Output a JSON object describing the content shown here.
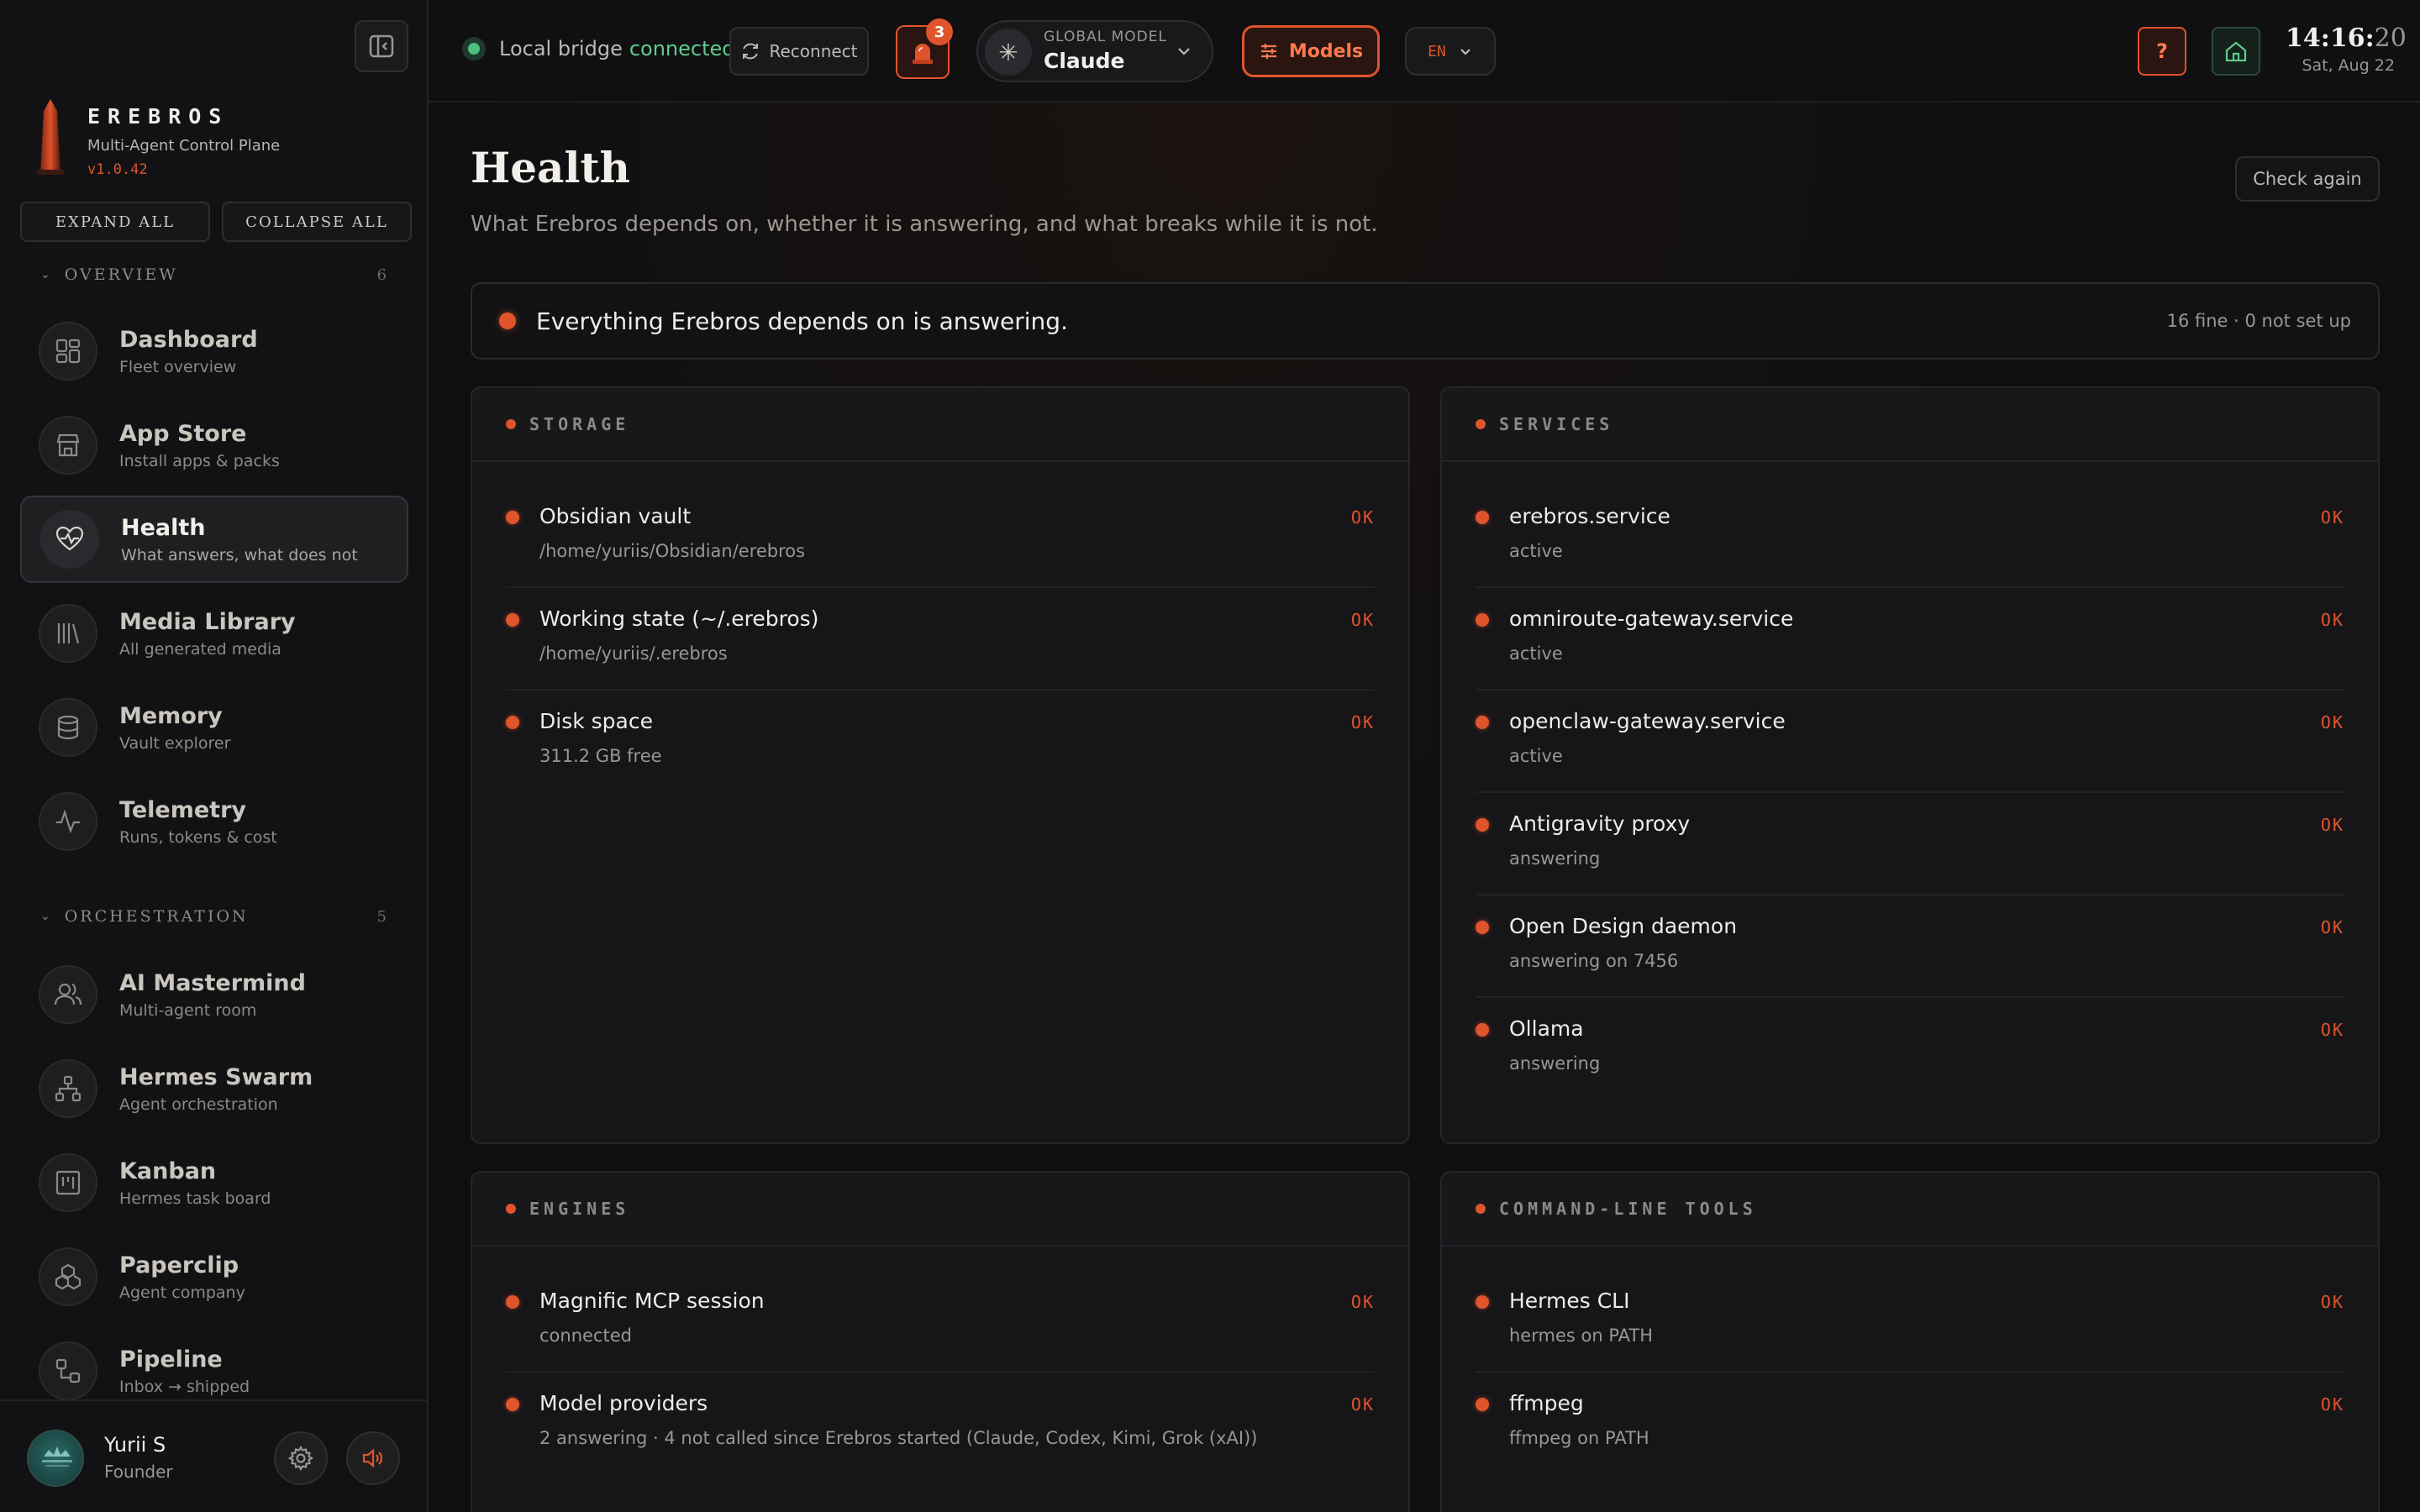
{
  "sidebar": {
    "brand": {
      "name": "EREBROS",
      "subtitle": "Multi-Agent Control Plane",
      "version": "v1.0.42"
    },
    "expand_all": "EXPAND ALL",
    "collapse_all": "COLLAPSE ALL",
    "sections": [
      {
        "label": "OVERVIEW",
        "count": "6"
      },
      {
        "label": "ORCHESTRATION",
        "count": "5"
      }
    ],
    "items": [
      {
        "title": "Dashboard",
        "subtitle": "Fleet overview",
        "icon": "dashboard-icon"
      },
      {
        "title": "App Store",
        "subtitle": "Install apps & packs",
        "icon": "store-icon"
      },
      {
        "title": "Health",
        "subtitle": "What answers, what does not",
        "icon": "heart-pulse-icon",
        "active": true
      },
      {
        "title": "Media Library",
        "subtitle": "All generated media",
        "icon": "library-icon"
      },
      {
        "title": "Memory",
        "subtitle": "Vault explorer",
        "icon": "database-icon"
      },
      {
        "title": "Telemetry",
        "subtitle": "Runs, tokens & cost",
        "icon": "activity-icon"
      },
      {
        "title": "AI Mastermind",
        "subtitle": "Multi-agent room",
        "icon": "users-icon"
      },
      {
        "title": "Hermes Swarm",
        "subtitle": "Agent orchestration",
        "icon": "network-icon"
      },
      {
        "title": "Kanban",
        "subtitle": "Hermes task board",
        "icon": "kanban-icon"
      },
      {
        "title": "Paperclip",
        "subtitle": "Agent company",
        "icon": "boxes-icon"
      },
      {
        "title": "Pipeline",
        "subtitle": "Inbox → shipped",
        "icon": "pipeline-icon"
      }
    ],
    "user": {
      "name": "Yurii S",
      "role": "Founder"
    }
  },
  "topbar": {
    "bridge_label": "Local bridge",
    "bridge_status": "connected",
    "reconnect": "Reconnect",
    "alarm_count": "3",
    "model_label": "GLOBAL MODEL",
    "model_value": "Claude",
    "models_button": "Models",
    "language": "EN",
    "help": "?",
    "clock_hm": "14:16:",
    "clock_s": "20",
    "date": "Sat, Aug 22"
  },
  "main": {
    "title": "Health",
    "subtitle": "What Erebros depends on, whether it is answering, and what breaks while it is not.",
    "check_again": "Check again",
    "summary_text": "Everything Erebros depends on is answering.",
    "summary_meta": "16 fine · 0 not set up",
    "cards": [
      {
        "title": "STORAGE",
        "rows": [
          {
            "name": "Obsidian vault",
            "detail": "/home/yuriis/Obsidian/erebros",
            "status": "OK"
          },
          {
            "name": "Working state (~/.erebros)",
            "detail": "/home/yuriis/.erebros",
            "status": "OK"
          },
          {
            "name": "Disk space",
            "detail": "311.2 GB free",
            "status": "OK"
          }
        ]
      },
      {
        "title": "SERVICES",
        "rows": [
          {
            "name": "erebros.service",
            "detail": "active",
            "status": "OK"
          },
          {
            "name": "omniroute-gateway.service",
            "detail": "active",
            "status": "OK"
          },
          {
            "name": "openclaw-gateway.service",
            "detail": "active",
            "status": "OK"
          },
          {
            "name": "Antigravity proxy",
            "detail": "answering",
            "status": "OK"
          },
          {
            "name": "Open Design daemon",
            "detail": "answering on 7456",
            "status": "OK"
          },
          {
            "name": "Ollama",
            "detail": "answering",
            "status": "OK"
          }
        ]
      },
      {
        "title": "ENGINES",
        "rows": [
          {
            "name": "Magnific MCP session",
            "detail": "connected",
            "status": "OK"
          },
          {
            "name": "Model providers",
            "detail": "2 answering · 4 not called since Erebros started (Claude, Codex, Kimi, Grok (xAI))",
            "status": "OK"
          }
        ]
      },
      {
        "title": "COMMAND-LINE TOOLS",
        "rows": [
          {
            "name": "Hermes CLI",
            "detail": "hermes on PATH",
            "status": "OK"
          },
          {
            "name": "ffmpeg",
            "detail": "ffmpeg on PATH",
            "status": "OK"
          }
        ]
      }
    ]
  },
  "colors": {
    "accent": "#e0542c",
    "connected": "#5ecb8c",
    "background": "#0f0f11"
  }
}
